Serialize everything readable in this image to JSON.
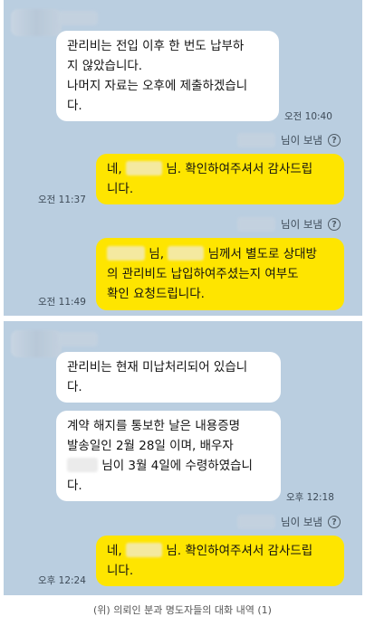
{
  "panel1": {
    "received": {
      "lines": [
        "관리비는 전입 이후 한 번도 납부하",
        "지 않았습니다.",
        "나머지 자료는 오후에 제출하겠습니",
        "다."
      ],
      "time": "오전 10:40"
    },
    "sent1": {
      "sender_label": "님이 보냄",
      "line1_pre": "네,",
      "line1_post": "님. 확인하여주셔서 감사드립",
      "line2": "니다.",
      "time": "오전 11:37"
    },
    "sent2": {
      "sender_label": "님이 보냄",
      "line1_mid": "님,",
      "line1_post": "님께서 별도로 상대방",
      "line2": "의 관리비도 납입하여주셨는지 여부도",
      "line3": "확인 요청드립니다.",
      "time": "오전 11:49"
    }
  },
  "panel2": {
    "received1": {
      "lines": [
        "관리비는 현재 미납처리되어 있습니",
        "다."
      ]
    },
    "received2": {
      "line1": "계약 해지를 통보한 날은 내용증명",
      "line2": "발송일인 2월 28일 이며, 배우자",
      "line3_post": "님이 3월 4일에 수령하였습니",
      "line4": "다.",
      "time": "오후 12:18"
    },
    "sent": {
      "sender_label": "님이 보냄",
      "line1_pre": "네,",
      "line1_post": "님. 확인하여주셔서 감사드립",
      "line2": "니다.",
      "time": "오후 12:24"
    }
  },
  "help_icon_glyph": "?",
  "caption": "(위) 의뢰인 분과 명도자들의 대화 내역 (1)",
  "colors": {
    "chat_background": "#bacee0",
    "sent_bubble": "#fee500",
    "received_bubble": "#ffffff"
  }
}
